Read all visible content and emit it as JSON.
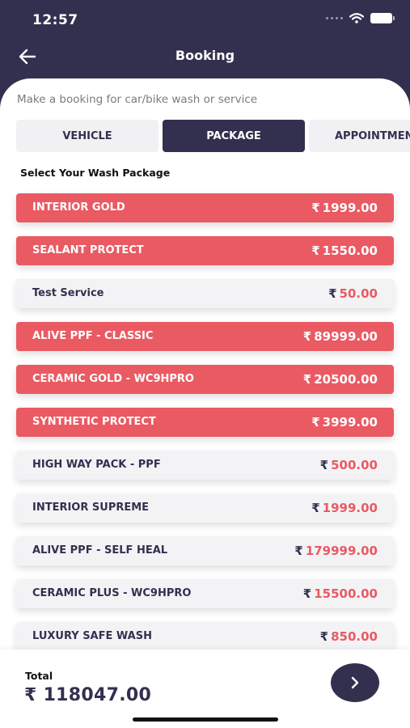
{
  "status_bar": {
    "time": "12:57"
  },
  "header": {
    "title": "Booking"
  },
  "subtitle": "Make a booking for car/bike wash or service",
  "tabs": [
    {
      "label": "VEHICLE",
      "active": false
    },
    {
      "label": "PACKAGE",
      "active": true
    },
    {
      "label": "APPOINTMENT",
      "active": false
    }
  ],
  "section_title": "Select Your Wash Package",
  "currency_symbol": "₹",
  "packages": [
    {
      "name": "INTERIOR GOLD",
      "price": "1999.00",
      "selected": true
    },
    {
      "name": "SEALANT PROTECT",
      "price": "1550.00",
      "selected": true
    },
    {
      "name": "Test Service",
      "price": "50.00",
      "selected": false
    },
    {
      "name": "ALIVE PPF - CLASSIC",
      "price": "89999.00",
      "selected": true
    },
    {
      "name": "CERAMIC GOLD - WC9HPRO",
      "price": "20500.00",
      "selected": true
    },
    {
      "name": "SYNTHETIC PROTECT",
      "price": "3999.00",
      "selected": true
    },
    {
      "name": "HIGH WAY PACK - PPF",
      "price": "500.00",
      "selected": false
    },
    {
      "name": "INTERIOR SUPREME",
      "price": "1999.00",
      "selected": false
    },
    {
      "name": "ALIVE PPF - SELF HEAL",
      "price": "179999.00",
      "selected": false
    },
    {
      "name": "CERAMIC PLUS - WC9HPRO",
      "price": "15500.00",
      "selected": false
    },
    {
      "name": "LUXURY SAFE WASH",
      "price": "850.00",
      "selected": false
    }
  ],
  "footer": {
    "total_label": "Total",
    "total_amount": "₹ 118047.00"
  },
  "colors": {
    "primary": "#33304f",
    "accent": "#ea5a63",
    "row_background": "#f3f3f5"
  },
  "icons": {
    "back": "arrow-left-icon",
    "next": "chevron-right-icon",
    "wifi": "wifi-icon",
    "battery": "battery-icon",
    "signal": "signal-icon"
  }
}
